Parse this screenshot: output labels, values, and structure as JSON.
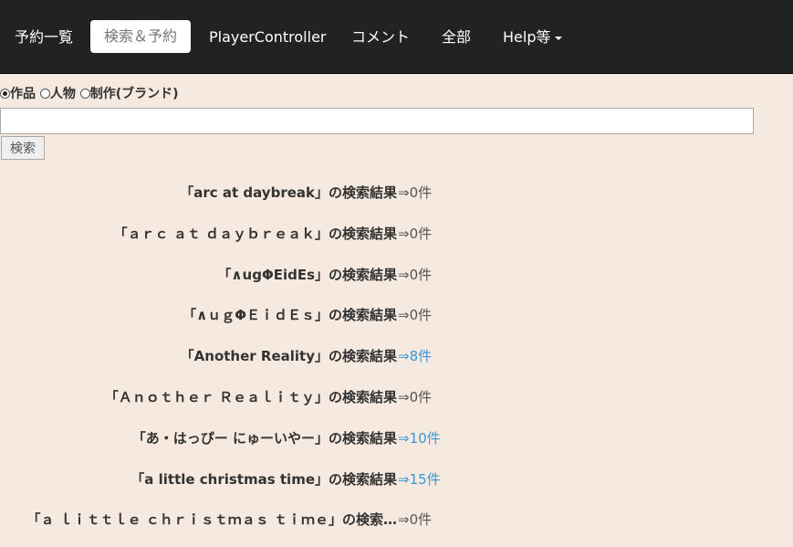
{
  "navbar": {
    "items": [
      {
        "label": "予約一覧"
      },
      {
        "label": "検索＆予約",
        "active": true
      },
      {
        "label": "PlayerController"
      },
      {
        "label": "コメント"
      },
      {
        "label": "全部"
      },
      {
        "label": "Help等"
      }
    ],
    "icons": {
      "dropdown": "caret-down-icon"
    }
  },
  "search": {
    "options": [
      {
        "label": "作品",
        "checked": true
      },
      {
        "label": "人物",
        "checked": false
      },
      {
        "label": "制作(ブランド)",
        "checked": false
      }
    ],
    "input_value": "",
    "button_label": "検索"
  },
  "results": [
    {
      "query": "「arc at daybreak」の検索結果",
      "count": "⇒0件",
      "has_results": false
    },
    {
      "query": "「ａｒｃ ａｔ ｄａｙｂｒｅａｋ」の検索結果",
      "count": "⇒0件",
      "has_results": false
    },
    {
      "query": "「∧ugΦEidEs」の検索結果",
      "count": "⇒0件",
      "has_results": false
    },
    {
      "query": "「∧ｕｇΦＥｉｄＥｓ」の検索結果",
      "count": "⇒0件",
      "has_results": false
    },
    {
      "query": "「Another Reality」の検索結果",
      "count": "⇒8件",
      "has_results": true
    },
    {
      "query": "「Ａｎｏｔｈｅｒ Ｒｅａｌｉｔｙ」の検索結果",
      "count": "⇒0件",
      "has_results": false
    },
    {
      "query": "「あ・はっぴー にゅーいやー」の検索結果",
      "count": "⇒10件",
      "has_results": true
    },
    {
      "query": "「a little christmas time」の検索結果",
      "count": "⇒15件",
      "has_results": true
    },
    {
      "query": "「ａ ｌｉｔｔｌｅ ｃｈｒｉｓｔｍａｓ ｔｉｍｅ」の検索…",
      "count": "⇒0件",
      "has_results": false
    }
  ],
  "colors": {
    "navbar_bg": "#222222",
    "page_bg": "#f6e9df",
    "link": "#3a97d4"
  }
}
